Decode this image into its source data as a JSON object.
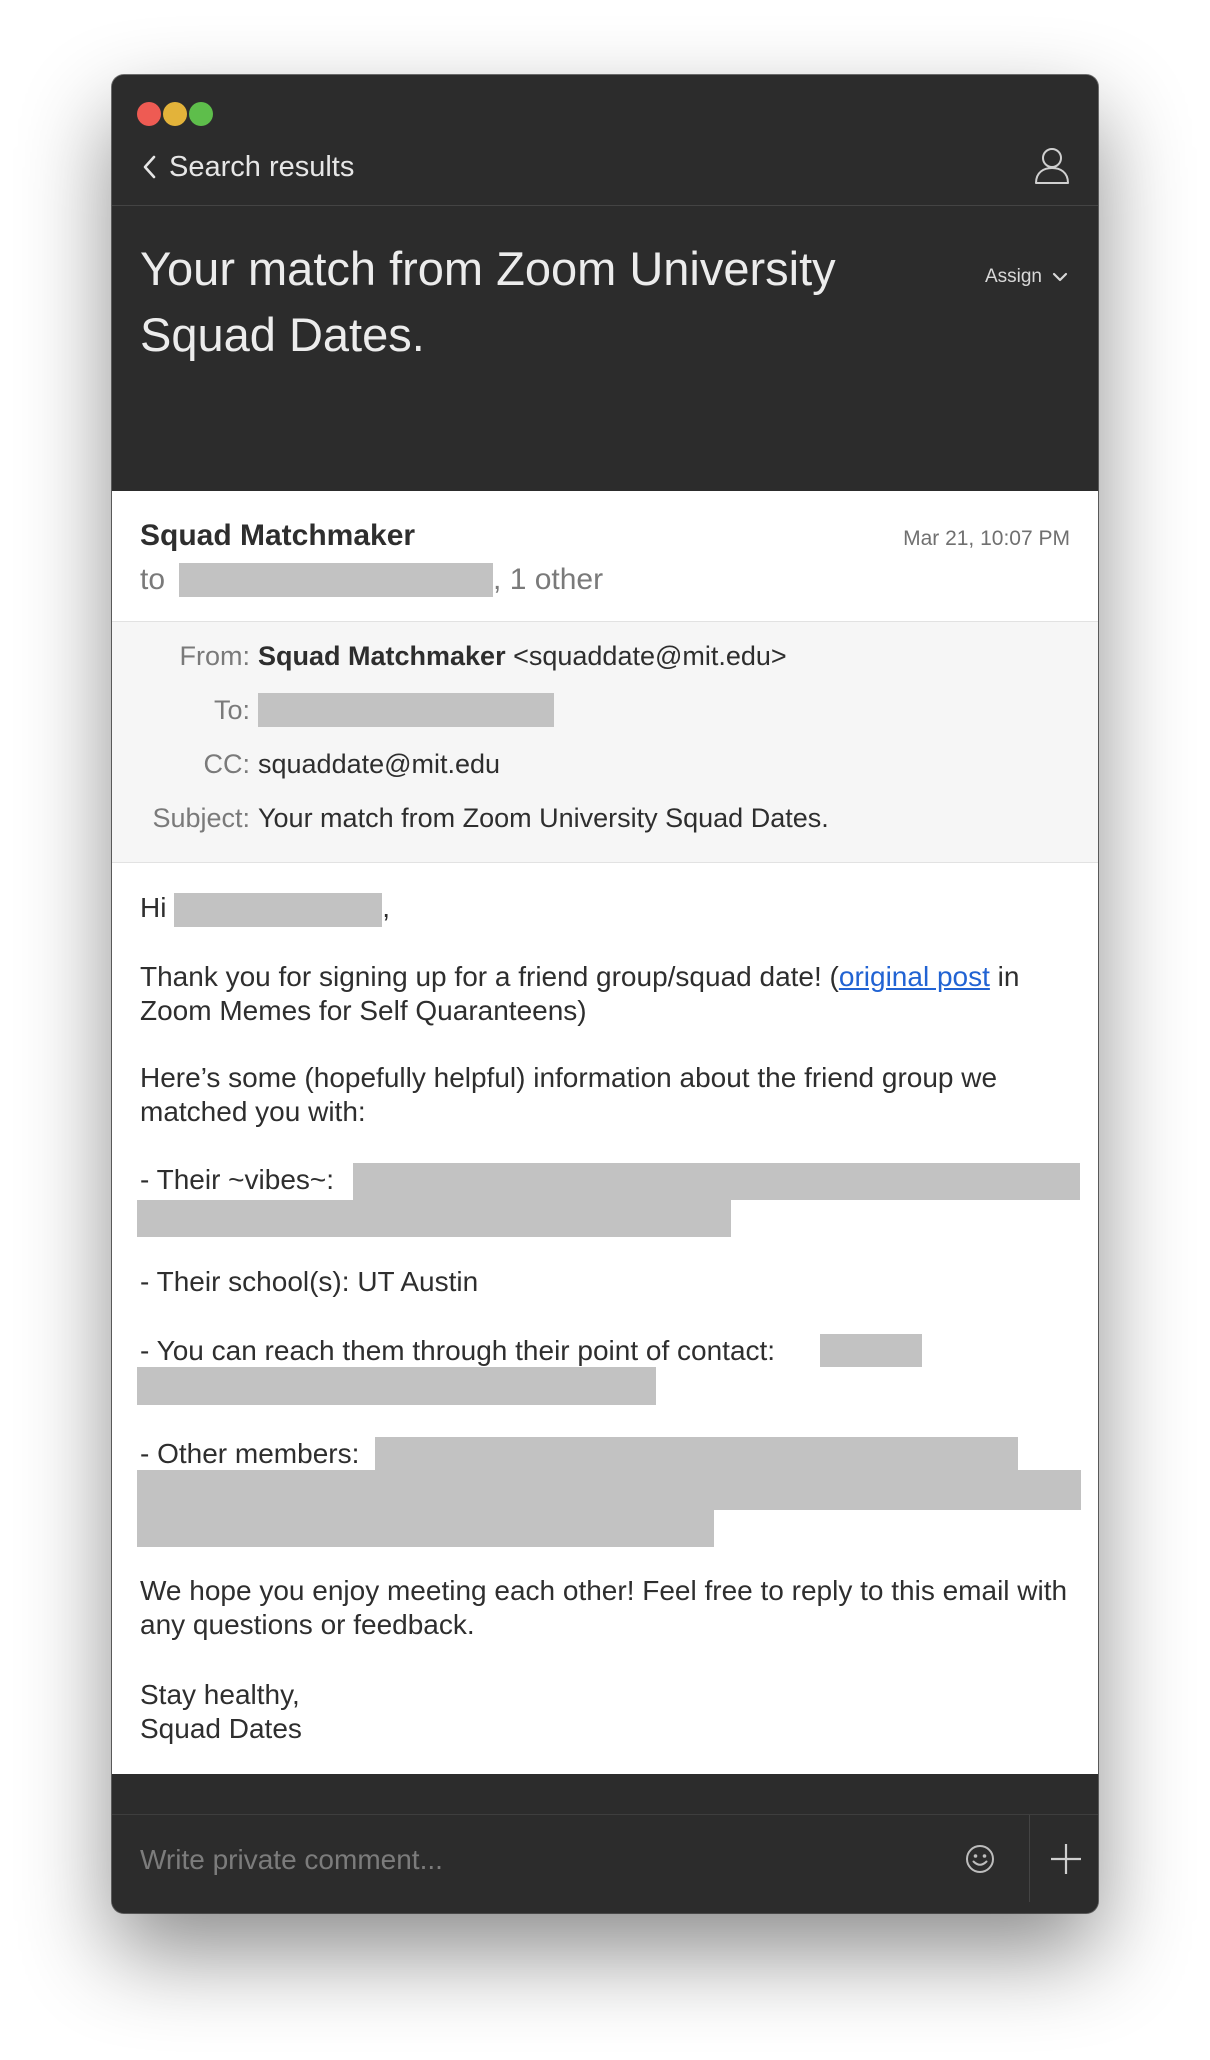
{
  "nav": {
    "back_label": "Search results"
  },
  "header": {
    "title": "Your match from Zoom University Squad Dates.",
    "assign_label": "Assign"
  },
  "email": {
    "sender": "Squad Matchmaker",
    "date": "Mar 21, 10:07 PM",
    "to_prefix": "to",
    "to_suffix": ", 1 other",
    "details": {
      "from_label": "From:",
      "from_name": "Squad Matchmaker",
      "from_email": "<squaddate@mit.edu>",
      "to_label": "To:",
      "cc_label": "CC:",
      "cc_value": "squaddate@mit.edu",
      "subject_label": "Subject:",
      "subject_value": "Your match from Zoom University Squad Dates."
    },
    "body": {
      "greeting_hi": "Hi",
      "greeting_end": ",",
      "para1_a": "Thank you for signing up for a friend group/squad date! (",
      "para1_link": "original post",
      "para1_b": " in Zoom Memes for Self Quaranteens)",
      "para2": "Here’s some (hopefully helpful) information about the friend group we matched you with:",
      "vibes_label": "- Their ~vibes~:",
      "school": "- Their school(s): UT Austin",
      "contact_label": "- You can reach them through their point of contact:",
      "members_label": "- Other members:",
      "para3": "We hope you enjoy meeting each other! Feel free to reply to this email with any questions or feedback.",
      "signoff_1": "Stay healthy,",
      "signoff_2": "Squad Dates"
    }
  },
  "comment": {
    "placeholder": "Write private comment..."
  },
  "toolbar_icons": [
    "reply-all-icon",
    "clock-icon",
    "inbox-tray-icon",
    "trash-icon",
    "more-icon",
    "person-icon"
  ],
  "colors": {
    "dark_bg": "#2c2c2c",
    "link": "#2163d3",
    "redaction": "#c2c2c2"
  }
}
